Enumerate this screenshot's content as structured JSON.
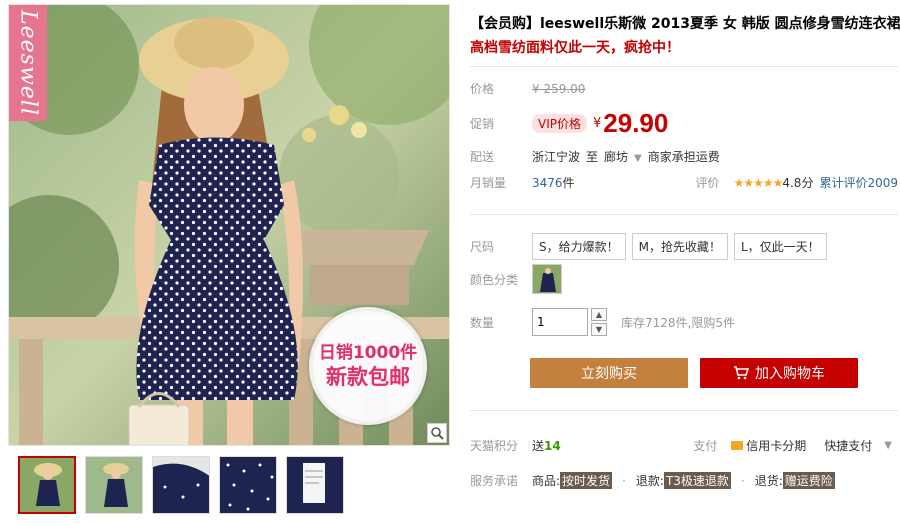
{
  "brand_tag": "Leeswell",
  "promo": {
    "line1": "日销1000件",
    "line2": "新款包邮"
  },
  "thumbnails": [
    "thumb-1",
    "thumb-2",
    "thumb-3",
    "thumb-4",
    "thumb-5"
  ],
  "product": {
    "title": "【会员购】leeswell乐斯微 2013夏季 女 韩版 圆点修身雪纺连衣裙",
    "subtitle": "高档雪纺面料仅此一天，疯抢中！"
  },
  "price_row": {
    "label": "价格",
    "original": "¥ 259.00"
  },
  "promo_row": {
    "label": "促销",
    "vip_badge": "VIP价格",
    "currency": "¥",
    "price": "29.90"
  },
  "shipping": {
    "label": "配送",
    "from": "浙江宁波",
    "to_word": "至",
    "to": "廊坊",
    "fee": "商家承担运费"
  },
  "sales": {
    "label": "月销量",
    "count": "3476",
    "unit": "件",
    "rating_label": "评价",
    "stars": "★★★★★",
    "score": "4.8分",
    "reviews": "累计评价2009"
  },
  "size": {
    "label": "尺码",
    "options": [
      "S，给力爆款！",
      "M，抢先收藏！",
      "L，仅此一天！"
    ]
  },
  "color": {
    "label": "颜色分类"
  },
  "quantity": {
    "label": "数量",
    "value": "1",
    "stock": "库存7128件,限购5件"
  },
  "buttons": {
    "buy_now": "立刻购买",
    "add_cart": "加入购物车"
  },
  "points": {
    "label": "天猫积分",
    "text": "送",
    "value": "14",
    "pay_label": "支付",
    "card": "信用卡分期",
    "express": "快捷支付"
  },
  "service": {
    "label": "服务承诺",
    "goods_label": "商品:",
    "goods_tag": "按时发货",
    "refund_label": "退款:",
    "refund_tag": "T3极速退款",
    "return_label": "退货:",
    "return_tag": "赠运费险"
  },
  "colors": {
    "accent_red": "#c40000",
    "buy_brown": "#c4803e",
    "brand_pink": "#e67690",
    "dress_navy": "#1f2350"
  }
}
